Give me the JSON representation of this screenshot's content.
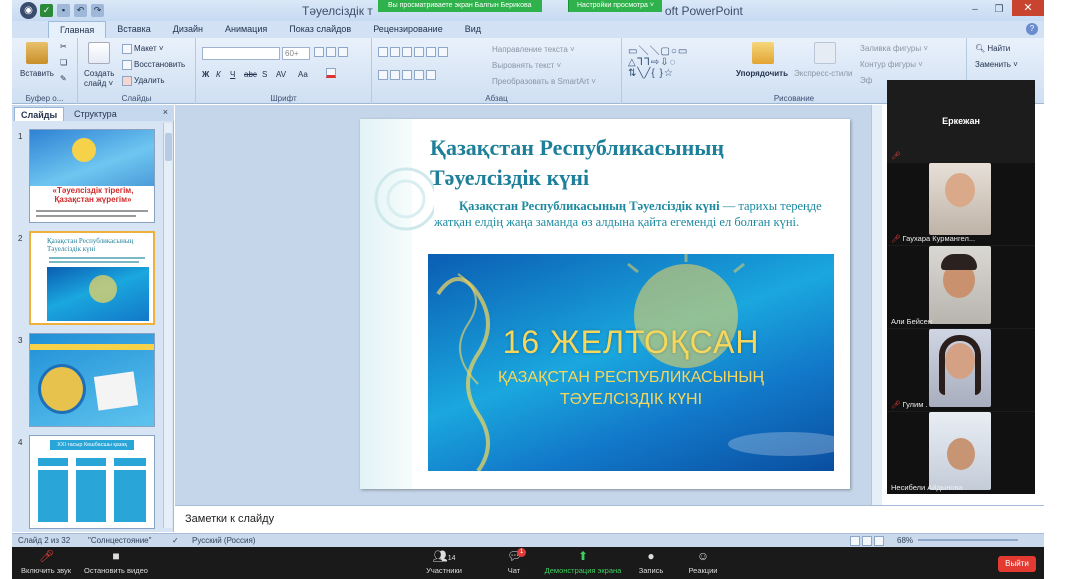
{
  "window": {
    "title_left": "Тәуелсіздік т",
    "title_right": "oft PowerPoint",
    "share_banner": "Вы просматриваете экран Балгын Берикова",
    "view_options": "Настройки просмотра ˅",
    "minimize": "–",
    "maximize": "❐",
    "close": "✕"
  },
  "tabs": [
    "Главная",
    "Вставка",
    "Дизайн",
    "Анимация",
    "Показ слайдов",
    "Рецензирование",
    "Вид"
  ],
  "ribbon": {
    "clipboard": {
      "paste": "Вставить",
      "label": "Буфер о..."
    },
    "slides": {
      "create": "Создать",
      "create2": "слайд ˅",
      "layout": "Макет ˅",
      "reset": "Восстановить",
      "delete": "Удалить",
      "label": "Слайды"
    },
    "font": {
      "size": "60+",
      "label": "Шрифт",
      "bold": "Ж",
      "italic": "К",
      "underline": "Ч",
      "strike": "abc",
      "shadow": "S",
      "spacing": "AV",
      "case": "Aa"
    },
    "paragraph": {
      "direction": "Направление текста ˅",
      "align": "Выровнять текст ˅",
      "smartart": "Преобразовать в SmartArt ˅",
      "label": "Абзац"
    },
    "drawing": {
      "arrange": "Упорядочить",
      "styles": "Экспресс-стили",
      "fill": "Заливка фигуры ˅",
      "outline": "Контур фигуры ˅",
      "effects": "Эф",
      "label": "Рисование"
    },
    "editing": {
      "find": "Найти",
      "replace": "Заменить ˅"
    }
  },
  "panel": {
    "tab_slides": "Слайды",
    "tab_outline": "Структура",
    "close": "×",
    "thumbs": [
      {
        "num": "1",
        "title": "«Тәуелсіздік тірегім, Қазақстан жүрегім»"
      },
      {
        "num": "2",
        "title": "Қазақстан Республикасының Тәуелсіздік күні"
      },
      {
        "num": "3"
      },
      {
        "num": "4",
        "title": "XXI ғасыр Көшбасшы қазақ"
      }
    ]
  },
  "slide": {
    "title": "Қазақстан Республикасының Тәуелсіздік күні",
    "body_bold": "Қазақстан Республикасының Тәуелсіздік күні",
    "body_rest": " — тарихы тереңде жатқан елдің жаңа заманда өз алдына қайта егеменді ел болған күні.",
    "img_date": "16 ЖЕЛТОҚСАН",
    "img_line1": "ҚАЗАҚСТАН РЕСПУБЛИКАСЫНЫҢ",
    "img_line2": "ТӘУЕЛСІЗДІК КҮНІ"
  },
  "notes": {
    "placeholder": "Заметки к слайду"
  },
  "status": {
    "slide": "Слайд 2 из 32",
    "theme": "\"Солнцестояние\"",
    "lang": "Русский (Россия)",
    "zoom": "68%"
  },
  "video": {
    "host": "Еркежан",
    "participants": [
      {
        "name": "Гаухара Курмангел..."
      },
      {
        "name": "Али Бейсен"
      },
      {
        "name": "Гулим ."
      },
      {
        "name": "Несибели Айдынова"
      }
    ]
  },
  "meeting": {
    "audio": "Включить звук",
    "video": "Остановить видео",
    "participants_count": "14",
    "participants": "Участники",
    "chat": "Чат",
    "chat_badge": "1",
    "share": "Демонстрация экрана",
    "record": "Запись",
    "reactions": "Реакции",
    "leave": "Выйти"
  },
  "colors": {
    "share_green": "#2fb24c",
    "leave_red": "#e33b32",
    "slide_title": "#1d7f9a"
  }
}
